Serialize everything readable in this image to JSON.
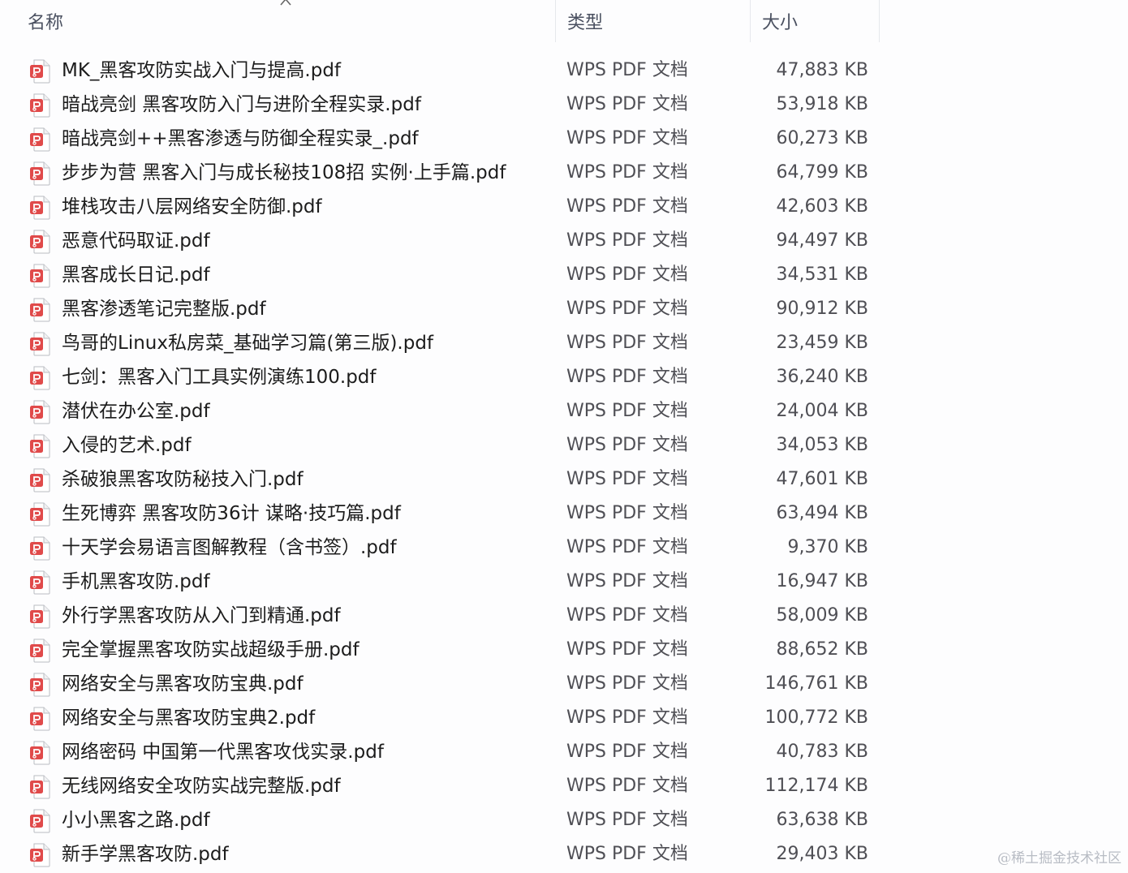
{
  "header": {
    "name_label": "名称",
    "type_label": "类型",
    "size_label": "大小",
    "sort_icon": "chevron-up-icon"
  },
  "colors": {
    "pdf_icon_red": "#e04a4a",
    "header_text": "#4a5060",
    "watermark": "#b8bcc4"
  },
  "files": [
    {
      "name": "MK_黑客攻防实战入门与提高.pdf",
      "type": "WPS PDF 文档",
      "size": "47,883 KB"
    },
    {
      "name": "暗战亮剑 黑客攻防入门与进阶全程实录.pdf",
      "type": "WPS PDF 文档",
      "size": "53,918 KB"
    },
    {
      "name": "暗战亮剑++黑客渗透与防御全程实录_.pdf",
      "type": "WPS PDF 文档",
      "size": "60,273 KB"
    },
    {
      "name": "步步为营 黑客入门与成长秘技108招 实例·上手篇.pdf",
      "type": "WPS PDF 文档",
      "size": "64,799 KB"
    },
    {
      "name": "堆栈攻击八层网络安全防御.pdf",
      "type": "WPS PDF 文档",
      "size": "42,603 KB"
    },
    {
      "name": "恶意代码取证.pdf",
      "type": "WPS PDF 文档",
      "size": "94,497 KB"
    },
    {
      "name": "黑客成长日记.pdf",
      "type": "WPS PDF 文档",
      "size": "34,531 KB"
    },
    {
      "name": "黑客渗透笔记完整版.pdf",
      "type": "WPS PDF 文档",
      "size": "90,912 KB"
    },
    {
      "name": "鸟哥的Linux私房菜_基础学习篇(第三版).pdf",
      "type": "WPS PDF 文档",
      "size": "23,459 KB"
    },
    {
      "name": "七剑：黑客入门工具实例演练100.pdf",
      "type": "WPS PDF 文档",
      "size": "36,240 KB"
    },
    {
      "name": "潜伏在办公室.pdf",
      "type": "WPS PDF 文档",
      "size": "24,004 KB"
    },
    {
      "name": "入侵的艺术.pdf",
      "type": "WPS PDF 文档",
      "size": "34,053 KB"
    },
    {
      "name": "杀破狼黑客攻防秘技入门.pdf",
      "type": "WPS PDF 文档",
      "size": "47,601 KB"
    },
    {
      "name": "生死博弈 黑客攻防36计 谋略·技巧篇.pdf",
      "type": "WPS PDF 文档",
      "size": "63,494 KB"
    },
    {
      "name": "十天学会易语言图解教程（含书签）.pdf",
      "type": "WPS PDF 文档",
      "size": "9,370 KB"
    },
    {
      "name": "手机黑客攻防.pdf",
      "type": "WPS PDF 文档",
      "size": "16,947 KB"
    },
    {
      "name": "外行学黑客攻防从入门到精通.pdf",
      "type": "WPS PDF 文档",
      "size": "58,009 KB"
    },
    {
      "name": "完全掌握黑客攻防实战超级手册.pdf",
      "type": "WPS PDF 文档",
      "size": "88,652 KB"
    },
    {
      "name": "网络安全与黑客攻防宝典.pdf",
      "type": "WPS PDF 文档",
      "size": "146,761 KB"
    },
    {
      "name": "网络安全与黑客攻防宝典2.pdf",
      "type": "WPS PDF 文档",
      "size": "100,772 KB"
    },
    {
      "name": "网络密码 中国第一代黑客攻伐实录.pdf",
      "type": "WPS PDF 文档",
      "size": "40,783 KB"
    },
    {
      "name": "无线网络安全攻防实战完整版.pdf",
      "type": "WPS PDF 文档",
      "size": "112,174 KB"
    },
    {
      "name": "小小黑客之路.pdf",
      "type": "WPS PDF 文档",
      "size": "63,638 KB"
    },
    {
      "name": "新手学黑客攻防.pdf",
      "type": "WPS PDF 文档",
      "size": "29,403 KB"
    }
  ],
  "watermark": "@稀土掘金技术社区"
}
